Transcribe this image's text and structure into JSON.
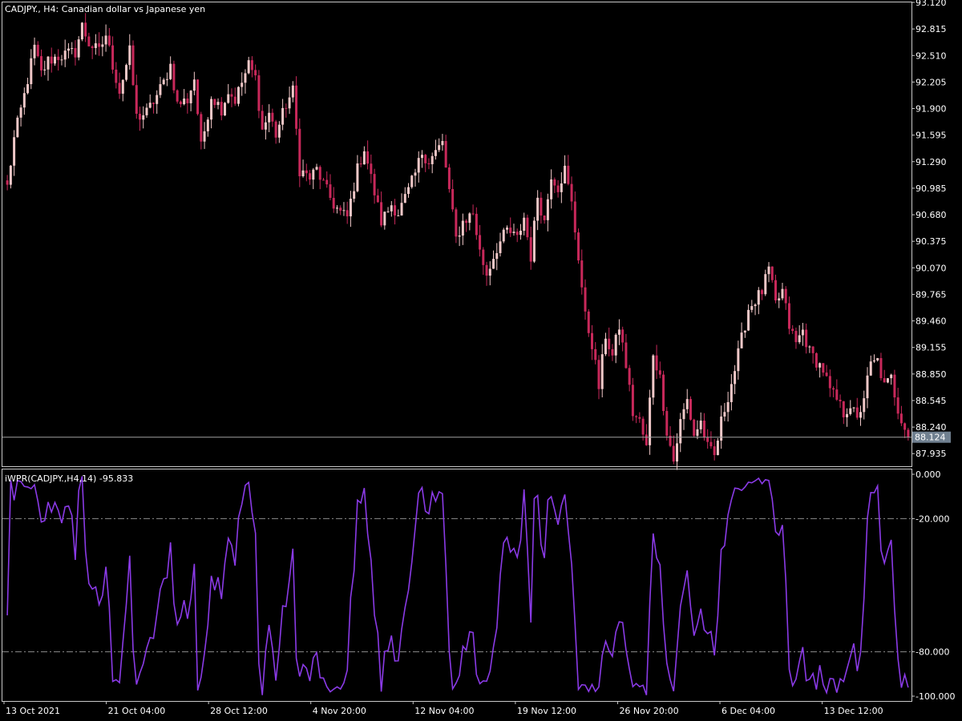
{
  "colors": {
    "background": "#000000",
    "frame": "#c8c8c8",
    "bull_candle": "#f0c8c8",
    "bear_candle": "#c8285a",
    "price_line": "#a0a0a0",
    "price_label_bg": "#708090",
    "wpr_line": "#8a3ae6",
    "level_line": "#8c8c8c",
    "text": "#ffffff"
  },
  "chart_data": [
    {
      "type": "candlestick",
      "title": "CADJPY., H4:  Canadian dollar vs Japanese yen",
      "y_ticks": [
        "93.120",
        "92.815",
        "92.510",
        "92.205",
        "91.900",
        "91.595",
        "91.290",
        "90.985",
        "90.680",
        "90.375",
        "90.070",
        "89.765",
        "89.460",
        "89.155",
        "88.850",
        "88.545",
        "88.240",
        "87.935"
      ],
      "ylim": [
        87.79,
        93.12
      ],
      "current_price": 88.124,
      "current_price_label": "88.124",
      "path_anchors": [
        [
          0,
          91.0
        ],
        [
          2,
          91.55
        ],
        [
          5,
          92.05
        ],
        [
          8,
          92.6
        ],
        [
          10,
          92.3
        ],
        [
          12,
          92.45
        ],
        [
          15,
          92.5
        ],
        [
          20,
          92.55
        ],
        [
          22,
          92.85
        ],
        [
          24,
          92.65
        ],
        [
          27,
          92.55
        ],
        [
          29,
          92.75
        ],
        [
          31,
          92.4
        ],
        [
          33,
          92.1
        ],
        [
          36,
          92.55
        ],
        [
          38,
          91.8
        ],
        [
          41,
          91.85
        ],
        [
          44,
          92.05
        ],
        [
          46,
          92.2
        ],
        [
          48,
          92.4
        ],
        [
          50,
          91.95
        ],
        [
          53,
          92.0
        ],
        [
          55,
          92.25
        ],
        [
          57,
          91.45
        ],
        [
          60,
          92.05
        ],
        [
          63,
          91.9
        ],
        [
          65,
          92.1
        ],
        [
          67,
          92.0
        ],
        [
          71,
          92.4
        ],
        [
          73,
          92.25
        ],
        [
          75,
          91.65
        ],
        [
          77,
          91.85
        ],
        [
          79,
          91.6
        ],
        [
          82,
          91.95
        ],
        [
          84,
          92.1
        ],
        [
          86,
          91.2
        ],
        [
          89,
          91.1
        ],
        [
          91,
          91.2
        ],
        [
          94,
          90.95
        ],
        [
          96,
          90.8
        ],
        [
          98,
          90.7
        ],
        [
          100,
          90.65
        ],
        [
          103,
          91.2
        ],
        [
          105,
          91.45
        ],
        [
          107,
          91.1
        ],
        [
          110,
          90.6
        ],
        [
          113,
          90.8
        ],
        [
          115,
          90.7
        ],
        [
          118,
          90.95
        ],
        [
          120,
          91.15
        ],
        [
          122,
          91.4
        ],
        [
          124,
          91.3
        ],
        [
          128,
          91.5
        ],
        [
          130,
          90.95
        ],
        [
          132,
          90.4
        ],
        [
          134,
          90.6
        ],
        [
          137,
          90.7
        ],
        [
          139,
          90.25
        ],
        [
          141,
          90.0
        ],
        [
          144,
          90.3
        ],
        [
          147,
          90.5
        ],
        [
          150,
          90.4
        ],
        [
          152,
          90.65
        ],
        [
          154,
          90.2
        ],
        [
          156,
          90.9
        ],
        [
          158,
          90.6
        ],
        [
          160,
          91.15
        ],
        [
          162,
          91.0
        ],
        [
          164,
          91.2
        ],
        [
          166,
          90.8
        ],
        [
          168,
          90.2
        ],
        [
          170,
          89.5
        ],
        [
          172,
          89.2
        ],
        [
          174,
          88.7
        ],
        [
          176,
          89.3
        ],
        [
          178,
          89.05
        ],
        [
          180,
          89.4
        ],
        [
          182,
          88.95
        ],
        [
          184,
          88.4
        ],
        [
          186,
          88.3
        ],
        [
          188,
          88.0
        ],
        [
          190,
          89.1
        ],
        [
          192,
          88.8
        ],
        [
          194,
          88.2
        ],
        [
          196,
          87.85
        ],
        [
          198,
          88.3
        ],
        [
          200,
          88.55
        ],
        [
          202,
          88.15
        ],
        [
          204,
          88.3
        ],
        [
          206,
          88.0
        ],
        [
          208,
          87.9
        ],
        [
          210,
          88.3
        ],
        [
          212,
          88.6
        ],
        [
          214,
          88.9
        ],
        [
          216,
          89.25
        ],
        [
          218,
          89.6
        ],
        [
          220,
          89.7
        ],
        [
          222,
          89.8
        ],
        [
          224,
          90.05
        ],
        [
          226,
          89.65
        ],
        [
          228,
          89.8
        ],
        [
          230,
          89.4
        ],
        [
          232,
          89.2
        ],
        [
          234,
          89.35
        ],
        [
          236,
          89.1
        ],
        [
          238,
          89.0
        ],
        [
          240,
          88.9
        ],
        [
          242,
          88.65
        ],
        [
          244,
          88.55
        ],
        [
          246,
          88.4
        ],
        [
          248,
          88.5
        ],
        [
          250,
          88.3
        ],
        [
          252,
          88.6
        ],
        [
          254,
          88.95
        ],
        [
          256,
          89.0
        ],
        [
          258,
          88.7
        ],
        [
          260,
          88.8
        ],
        [
          262,
          88.45
        ],
        [
          264,
          88.25
        ],
        [
          265,
          88.124
        ]
      ]
    },
    {
      "type": "line",
      "title": "iWPR(CADJPY.,H4,14) -95.833",
      "y_ticks": [
        "0.000",
        "-20.000",
        "-80.000",
        "-100.000"
      ],
      "ylim": [
        -100,
        0
      ],
      "levels": [
        -20,
        -80
      ]
    }
  ],
  "x_axis": {
    "ticks": [
      "13 Oct 2021",
      "21 Oct 04:00",
      "28 Oct 12:00",
      "4 Nov 20:00",
      "12 Nov 04:00",
      "19 Nov 12:00",
      "26 Nov 20:00",
      "6 Dec 04:00",
      "13 Dec 12:00"
    ]
  }
}
